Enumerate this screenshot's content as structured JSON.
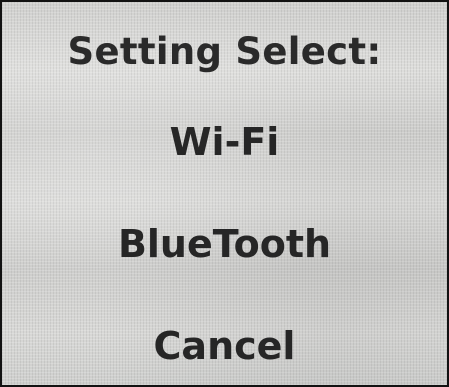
{
  "dialog": {
    "title": "Setting Select:",
    "options": [
      {
        "label": "Wi-Fi"
      },
      {
        "label": "BlueTooth"
      },
      {
        "label": "Cancel"
      }
    ]
  }
}
